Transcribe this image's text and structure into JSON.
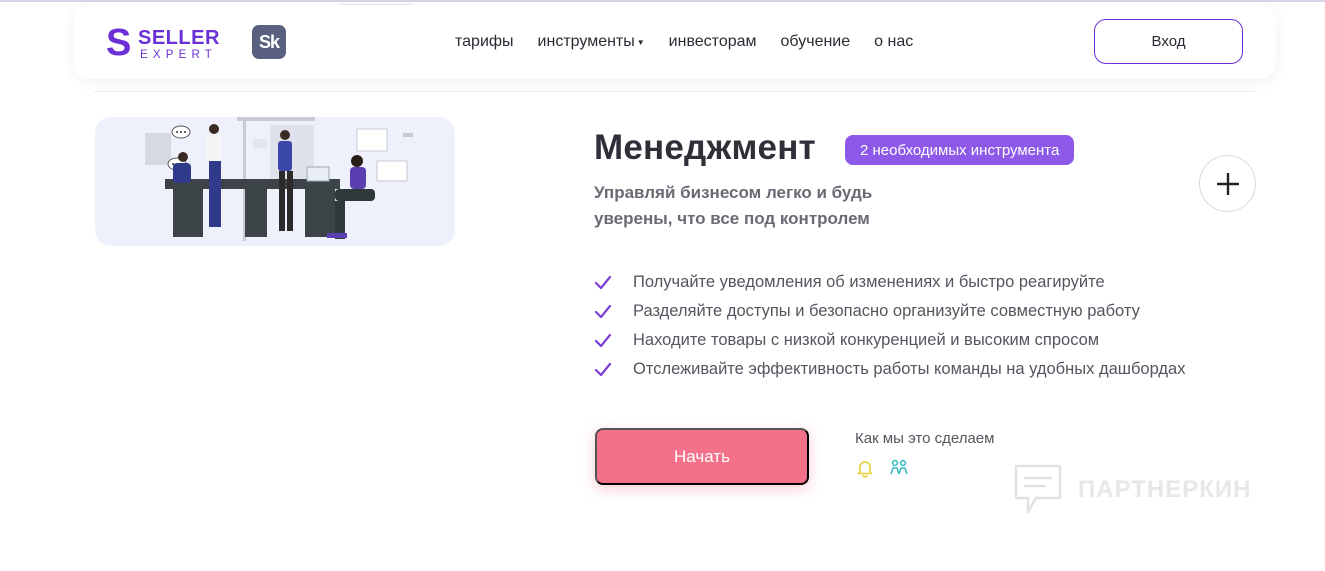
{
  "header": {
    "logo": {
      "mark": "S",
      "line1": "SELLER",
      "line2": "EXPERT"
    },
    "partner_badge": "Sk",
    "nav": [
      {
        "label": "тарифы",
        "has_dropdown": false
      },
      {
        "label": "инструменты",
        "has_dropdown": true
      },
      {
        "label": "инвесторам",
        "has_dropdown": false
      },
      {
        "label": "обучение",
        "has_dropdown": false
      },
      {
        "label": "о нас",
        "has_dropdown": false
      }
    ],
    "login_label": "Вход"
  },
  "section": {
    "title": "Менеджмент",
    "tag": "2 необходимых инструмента",
    "subtitle": "Управляй бизнесом легко и будь уверены, что все под контролем",
    "features": [
      "Получайте уведомления об изменениях и быстро реагируйте",
      "Разделяйте доступы и безопасно организуйте совместную работу",
      "Находите товары с низкой конкуренцией и высоким спросом",
      "Отслеживайте эффективность работы команды на удобных дашбордах"
    ],
    "start_label": "Начать",
    "how_label": "Как мы это сделаем",
    "how_icons": [
      "bell-icon",
      "team-icon"
    ]
  },
  "watermark": "ПАРТНЕРКИН",
  "colors": {
    "brand_purple": "#6a2fd6",
    "tag_purple": "#8e58e8",
    "cta_pink": "#f4718a",
    "bell_yellow": "#e8d64a",
    "team_teal": "#3cbcc4"
  }
}
